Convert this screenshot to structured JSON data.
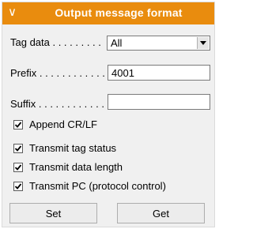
{
  "header": {
    "title": "Output message format",
    "collapse_glyph": "∨",
    "color": "#e98c0e"
  },
  "fields": {
    "tag_data": {
      "label": "Tag data . . . . . . . . .",
      "value": "All"
    },
    "prefix": {
      "label": "Prefix . . . . . . . . . . . .",
      "value": "4001"
    },
    "suffix": {
      "label": "Suffix . . . . . . . . . . . .",
      "value": ""
    }
  },
  "checks": {
    "append_crlf": {
      "label": "Append CR/LF",
      "checked": true
    },
    "tag_status": {
      "label": "Transmit tag status",
      "checked": true
    },
    "data_length": {
      "label": "Transmit data length",
      "checked": true
    },
    "pc": {
      "label": "Transmit PC (protocol control)",
      "checked": true
    }
  },
  "buttons": {
    "set": "Set",
    "get": "Get"
  }
}
